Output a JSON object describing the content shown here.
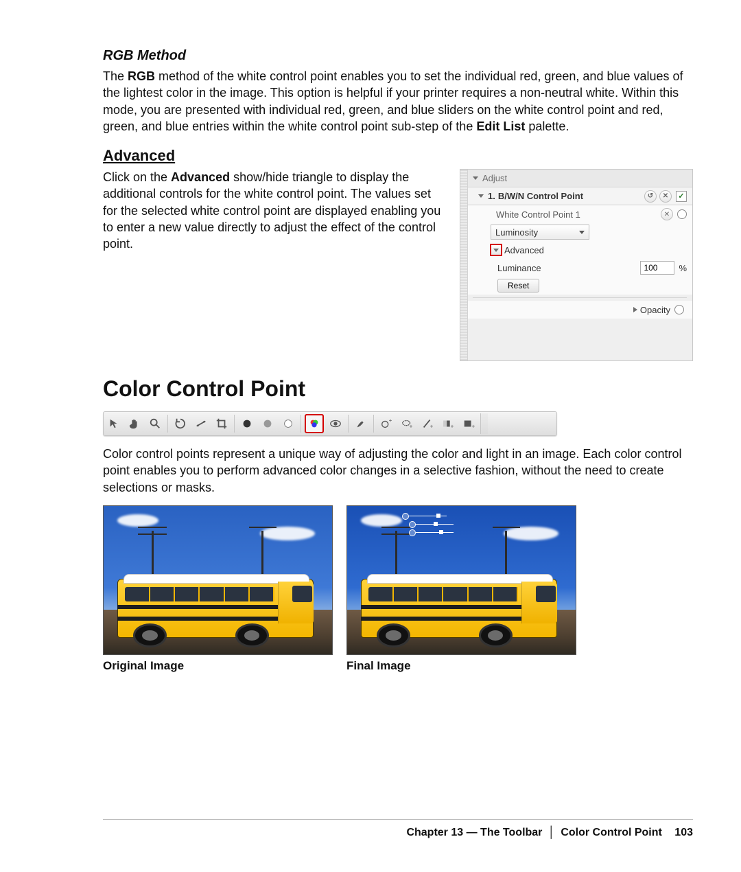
{
  "rgb": {
    "heading": "RGB Method",
    "body_pre": "The ",
    "body_bold1": "RGB",
    "body_mid": " method of the white control point enables you to set the individual red, green, and blue values of the lightest color in the image. This option is helpful if your printer requires a non-neutral white. Within this mode, you are presented with individual red, green, and blue sliders on the white control point and red, green, and blue entries within the white control point sub-step of the ",
    "body_bold2": "Edit List",
    "body_post": " palette."
  },
  "advanced": {
    "heading": "Advanced",
    "body_pre": "Click on the ",
    "body_bold": "Advanced",
    "body_post": " show/hide triangle to display the additional controls for the white control point. The values set for the selected white control point are displayed enabling you to enter a new value directly to adjust the effect of the control point."
  },
  "panel": {
    "adjust": "Adjust",
    "section_number": "1.",
    "section_name": "B/W/N Control Point",
    "sub_name": "White Control Point 1",
    "mode_select": "Luminosity",
    "advanced_label": "Advanced",
    "prop_label": "Luminance",
    "prop_value": "100",
    "prop_unit": "%",
    "reset": "Reset",
    "opacity": "Opacity"
  },
  "ccp": {
    "heading": "Color Control Point",
    "body": "Color control points represent a unique way of adjusting the color and light in an image. Each color control point enables you to perform advanced color changes in a selective fashion, without the need to create selections or masks."
  },
  "examples": {
    "original": "Original Image",
    "final": "Final Image"
  },
  "toolbar_icons": [
    "arrow",
    "hand",
    "zoom",
    "rotate",
    "straighten",
    "crop",
    "black-cp",
    "gray-cp",
    "white-cp",
    "color-cp",
    "redeye",
    "brush",
    "selective-1",
    "selective-2",
    "line-tool",
    "gradient-tool",
    "contrast-tool"
  ],
  "footer": {
    "chapter": "Chapter 13 — The Toolbar",
    "section": "Color Control Point",
    "page": "103"
  }
}
